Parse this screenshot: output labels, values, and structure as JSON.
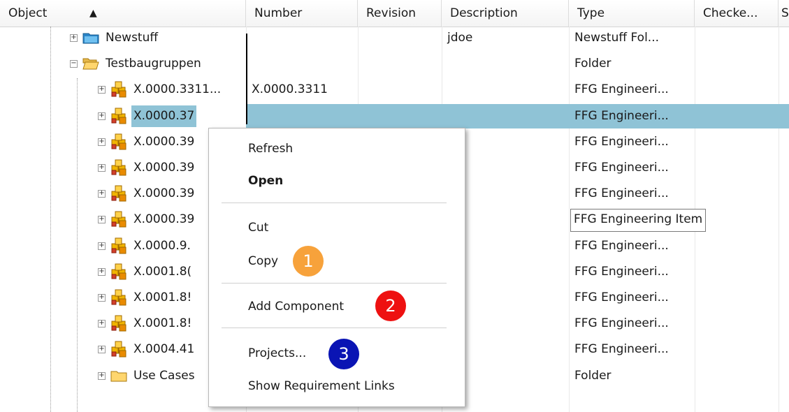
{
  "header": {
    "columns": [
      "Object",
      "Number",
      "Revision",
      "Description",
      "Type",
      "Checke...",
      "S"
    ]
  },
  "rows": [
    {
      "object": "Newstuff",
      "number": "",
      "revision": "",
      "description": "jdoe",
      "type": "Newstuff Fol...",
      "icon": "newstuff-folder-icon",
      "expand": "+"
    },
    {
      "object": "Testbaugruppen",
      "number": "",
      "revision": "",
      "description": "",
      "type": "Folder",
      "icon": "open-folder-icon",
      "expand": "−"
    },
    {
      "object": "X.0000.3311...",
      "number": "X.0000.3311",
      "revision": "",
      "description": "",
      "type": "FFG Engineeri...",
      "icon": "item-icon",
      "expand": "+"
    },
    {
      "object": "X.0000.37",
      "number": "",
      "revision": "",
      "description": "",
      "type": "FFG Engineeri...",
      "icon": "item-icon",
      "expand": "+",
      "selected": true
    },
    {
      "object": "X.0000.39",
      "number": "",
      "revision": "",
      "description": "",
      "type": "FFG Engineeri...",
      "icon": "item-icon",
      "expand": "+"
    },
    {
      "object": "X.0000.39",
      "number": "",
      "revision": "",
      "description": "",
      "type": "FFG Engineeri...",
      "icon": "item-icon",
      "expand": "+"
    },
    {
      "object": "X.0000.39",
      "number": "",
      "revision": "",
      "description": "",
      "type": "FFG Engineeri...",
      "icon": "item-icon",
      "expand": "+"
    },
    {
      "object": "X.0000.39",
      "number": "",
      "revision": "",
      "description": "",
      "type": "FFG Engineering Item",
      "icon": "item-icon",
      "expand": "+",
      "editing": true
    },
    {
      "object": "X.0000.9.",
      "number": "",
      "revision": "",
      "description": "",
      "type": "FFG Engineeri...",
      "icon": "item-icon",
      "expand": "+"
    },
    {
      "object": "X.0001.8(",
      "number": "",
      "revision": "",
      "description": "",
      "type": "FFG Engineeri...",
      "icon": "item-icon",
      "expand": "+"
    },
    {
      "object": "X.0001.8!",
      "number": "",
      "revision": "",
      "description": "",
      "type": "FFG Engineeri...",
      "icon": "item-icon",
      "expand": "+"
    },
    {
      "object": "X.0001.8!",
      "number": "",
      "revision": "",
      "description": "",
      "type": "FFG Engineeri...",
      "icon": "item-icon",
      "expand": "+"
    },
    {
      "object": "X.0004.41",
      "number": "",
      "revision": "",
      "description": "",
      "type": "FFG Engineeri...",
      "icon": "item-icon",
      "expand": "+"
    },
    {
      "object": "Use Cases",
      "number": "",
      "revision": "",
      "description": "",
      "type": "Folder",
      "icon": "folder-icon",
      "expand": "+"
    }
  ],
  "context_menu": {
    "items": [
      {
        "label": "Refresh",
        "bold": false
      },
      {
        "label": "Open",
        "bold": true
      },
      {
        "label": "Cut",
        "bold": false
      },
      {
        "label": "Copy",
        "bold": false
      },
      {
        "label": "Add Component",
        "bold": false
      },
      {
        "label": "Projects...",
        "bold": false
      },
      {
        "label": "Show Requirement Links",
        "bold": false
      }
    ]
  },
  "badges": [
    {
      "number": "1",
      "color": "#f7a23b"
    },
    {
      "number": "2",
      "color": "#ee1111"
    },
    {
      "number": "3",
      "color": "#0a14b4"
    }
  ],
  "colors": {
    "selection": "#8fc3d6"
  }
}
